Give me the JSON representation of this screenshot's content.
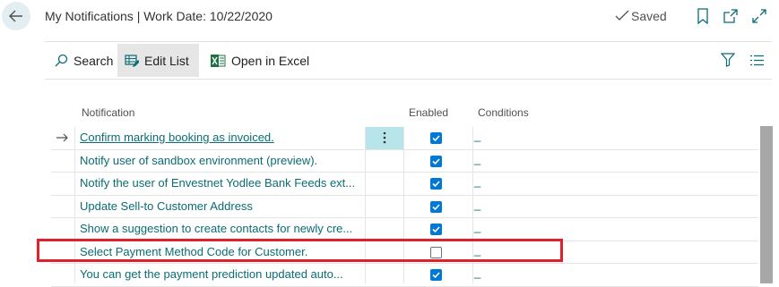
{
  "header": {
    "title": "My Notifications | Work Date: 10/22/2020",
    "saved_label": "Saved"
  },
  "toolbar": {
    "search_label": "Search",
    "edit_list_label": "Edit List",
    "open_in_excel_label": "Open in Excel"
  },
  "columns": {
    "notification": "Notification",
    "enabled": "Enabled",
    "conditions": "Conditions"
  },
  "rows": [
    {
      "name": "Confirm marking booking as invoiced.",
      "enabled": true,
      "condition": "_",
      "current": true
    },
    {
      "name": "Notify user of sandbox environment (preview).",
      "enabled": true,
      "condition": "_",
      "current": false
    },
    {
      "name": "Notify the user of Envestnet Yodlee Bank Feeds ext...",
      "enabled": true,
      "condition": "_",
      "current": false
    },
    {
      "name": "Update Sell-to Customer Address",
      "enabled": true,
      "condition": "_",
      "current": false
    },
    {
      "name": "Show a suggestion to create contacts for newly cre...",
      "enabled": true,
      "condition": "_",
      "current": false
    },
    {
      "name": "Select Payment Method Code for Customer.",
      "enabled": false,
      "condition": "_",
      "current": false
    },
    {
      "name": "You can get the payment prediction updated auto...",
      "enabled": true,
      "condition": "_",
      "current": false
    }
  ],
  "colors": {
    "accent": "#0078d4",
    "link": "#0a6c74",
    "highlight_box": "#e2202b",
    "selected_cell": "#b7e5ea"
  }
}
